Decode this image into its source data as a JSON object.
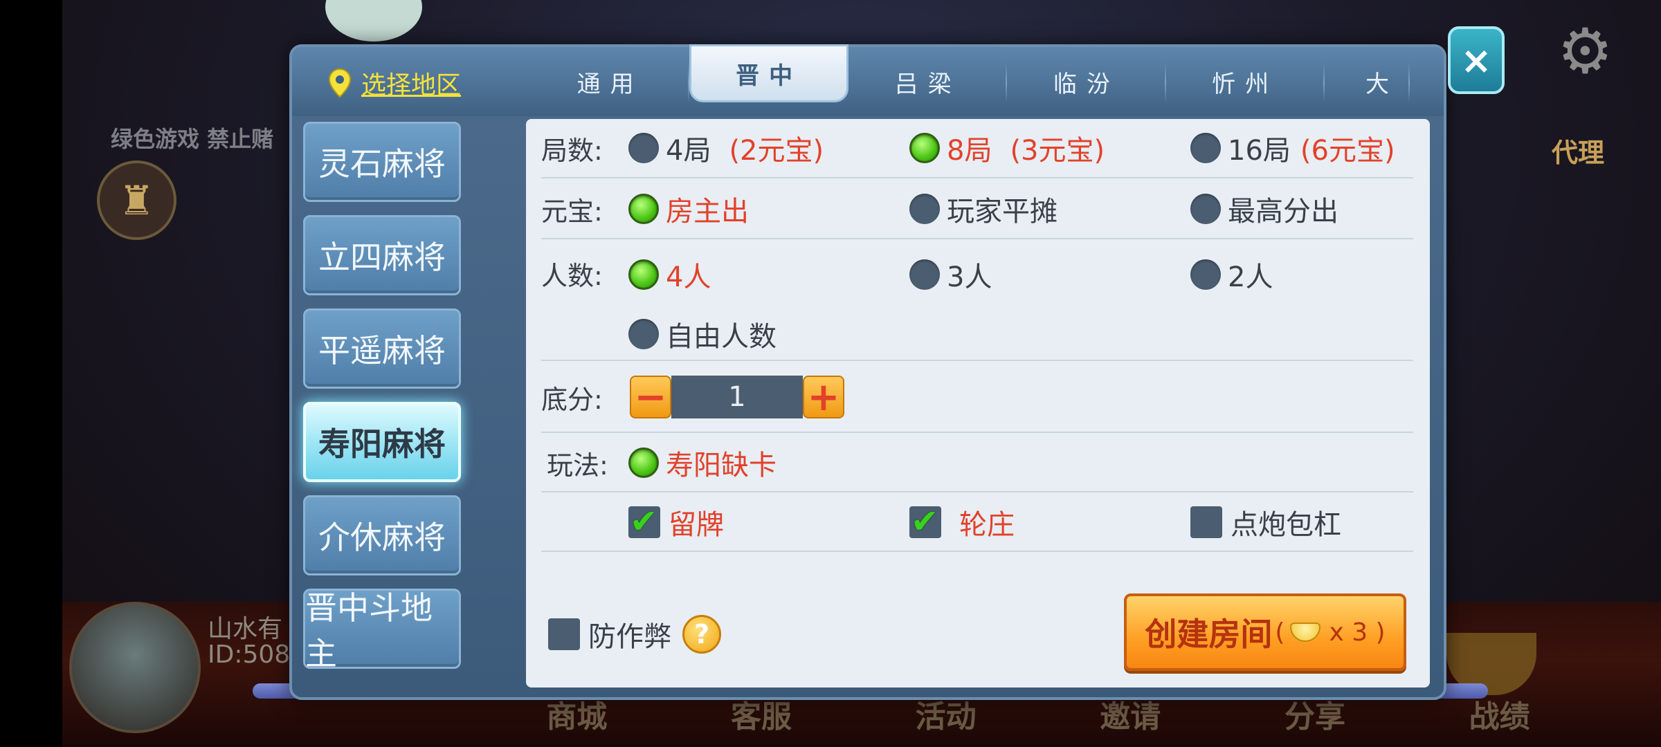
{
  "background": {
    "notice": "绿色游戏 禁止赌",
    "player_name": "山水有",
    "player_id": "ID:508",
    "agent_label": "代理",
    "bottom_tabs": [
      "商城",
      "客服",
      "活动",
      "邀请",
      "分享",
      "战绩"
    ]
  },
  "header": {
    "region_select_label": "选择地区",
    "tabs": [
      "通用",
      "晋中",
      "吕梁",
      "临汾",
      "忻州",
      "大"
    ],
    "active_tab": "晋中",
    "close_label": "×"
  },
  "sidenav": {
    "items": [
      "灵石麻将",
      "立四麻将",
      "平遥麻将",
      "寿阳麻将",
      "介休麻将",
      "晋中斗地主"
    ],
    "active_item": "寿阳麻将"
  },
  "options": {
    "rounds": {
      "label": "局数:",
      "choices": [
        {
          "text": "4局",
          "price": "(2元宝)",
          "selected": false
        },
        {
          "text": "8局",
          "price": "(3元宝)",
          "selected": true
        },
        {
          "text": "16局",
          "price": "(6元宝)",
          "selected": false
        }
      ]
    },
    "payment": {
      "label": "元宝:",
      "choices": [
        {
          "text": "房主出",
          "selected": true
        },
        {
          "text": "玩家平摊",
          "selected": false
        },
        {
          "text": "最高分出",
          "selected": false
        }
      ]
    },
    "players": {
      "label": "人数:",
      "choices": [
        {
          "text": "4人",
          "selected": true
        },
        {
          "text": "3人",
          "selected": false
        },
        {
          "text": "2人",
          "selected": false
        },
        {
          "text": "自由人数",
          "selected": false
        }
      ]
    },
    "base_score": {
      "label": "底分:",
      "minus": "−",
      "value": "1",
      "plus": "+"
    },
    "play_mode": {
      "label": "玩法:",
      "choices": [
        {
          "text": "寿阳缺卡",
          "selected": true
        }
      ]
    },
    "extras": [
      {
        "text": "留牌",
        "checked": true
      },
      {
        "text": "轮庄",
        "checked": true
      },
      {
        "text": "点炮包杠",
        "checked": false
      }
    ]
  },
  "footer": {
    "anticheat_label": "防作弊",
    "anticheat_checked": false,
    "help_label": "?",
    "create_label": "创建房间",
    "create_cost": "x 3 )",
    "create_open_paren": "("
  }
}
